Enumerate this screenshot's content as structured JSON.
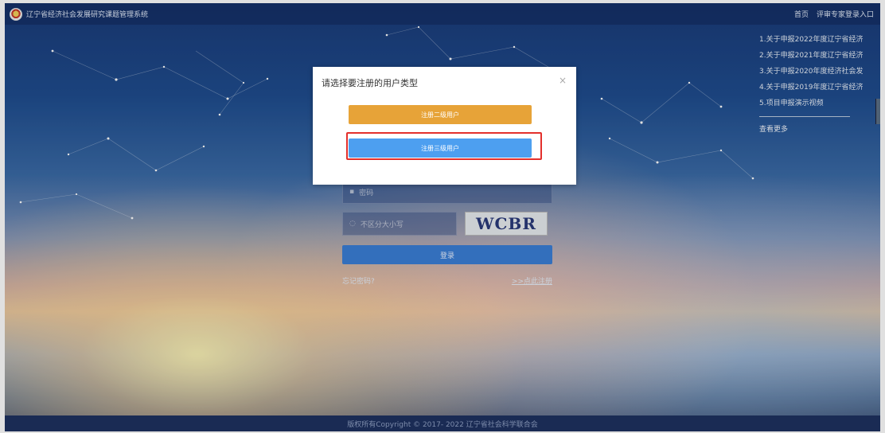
{
  "header": {
    "site_title": "辽宁省经济社会发展研究课题管理系统",
    "links": [
      "首页",
      "评审专家登录入口"
    ]
  },
  "news": {
    "items": [
      "1.关于申报2022年度辽宁省经济...",
      "2.关于申报2021年度辽宁省经济...",
      "3.关于申报2020年度经济社会发...",
      "4.关于申报2019年度辽宁省经济...",
      "5.项目申报演示视频"
    ],
    "more": "查看更多"
  },
  "login": {
    "password_placeholder": "密码",
    "captcha_placeholder": "不区分大小写",
    "captcha_text": "WCBR",
    "login_button": "登录",
    "forgot": "忘记密码?",
    "register": ">>点此注册"
  },
  "modal": {
    "title": "请选择要注册的用户类型",
    "close": "×",
    "level2_button": "注册二级用户",
    "level3_button": "注册三级用户"
  },
  "footer": {
    "copyright": "版权所有Copyright © 2017- 2022 辽宁省社会科学联合会"
  },
  "colors": {
    "level2": "#e7a338",
    "level3": "#4d9ff0",
    "highlight": "#e3302c"
  }
}
